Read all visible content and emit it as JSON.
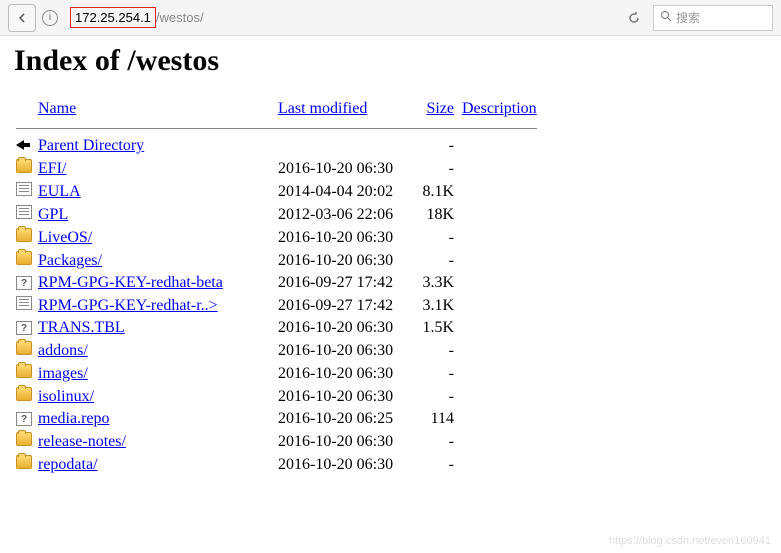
{
  "toolbar": {
    "url_highlighted": "172.25.254.1",
    "url_rest": "/westos/",
    "search_placeholder": "搜索"
  },
  "page": {
    "heading": "Index of /westos"
  },
  "headers": {
    "name": "Name",
    "modified": "Last modified",
    "size": "Size",
    "description": "Description"
  },
  "rows": [
    {
      "icon": "back",
      "name": "Parent Directory",
      "date": "",
      "size": "-"
    },
    {
      "icon": "folder",
      "name": "EFI/",
      "date": "2016-10-20 06:30",
      "size": "-"
    },
    {
      "icon": "text",
      "name": "EULA",
      "date": "2014-04-04 20:02",
      "size": "8.1K"
    },
    {
      "icon": "text",
      "name": "GPL",
      "date": "2012-03-06 22:06",
      "size": "18K"
    },
    {
      "icon": "folder",
      "name": "LiveOS/",
      "date": "2016-10-20 06:30",
      "size": "-"
    },
    {
      "icon": "folder",
      "name": "Packages/",
      "date": "2016-10-20 06:30",
      "size": "-"
    },
    {
      "icon": "unknown",
      "name": "RPM-GPG-KEY-redhat-beta",
      "date": "2016-09-27 17:42",
      "size": "3.3K"
    },
    {
      "icon": "text",
      "name": "RPM-GPG-KEY-redhat-r..>",
      "date": "2016-09-27 17:42",
      "size": "3.1K"
    },
    {
      "icon": "unknown",
      "name": "TRANS.TBL",
      "date": "2016-10-20 06:30",
      "size": "1.5K"
    },
    {
      "icon": "folder",
      "name": "addons/",
      "date": "2016-10-20 06:30",
      "size": "-"
    },
    {
      "icon": "folder",
      "name": "images/",
      "date": "2016-10-20 06:30",
      "size": "-"
    },
    {
      "icon": "folder",
      "name": "isolinux/",
      "date": "2016-10-20 06:30",
      "size": "-"
    },
    {
      "icon": "unknown",
      "name": "media.repo",
      "date": "2016-10-20 06:25",
      "size": "114"
    },
    {
      "icon": "folder",
      "name": "release-notes/",
      "date": "2016-10-20 06:30",
      "size": "-"
    },
    {
      "icon": "folder",
      "name": "repodata/",
      "date": "2016-10-20 06:30",
      "size": "-"
    }
  ],
  "watermark": "https://blog.csdn.net/even160941"
}
